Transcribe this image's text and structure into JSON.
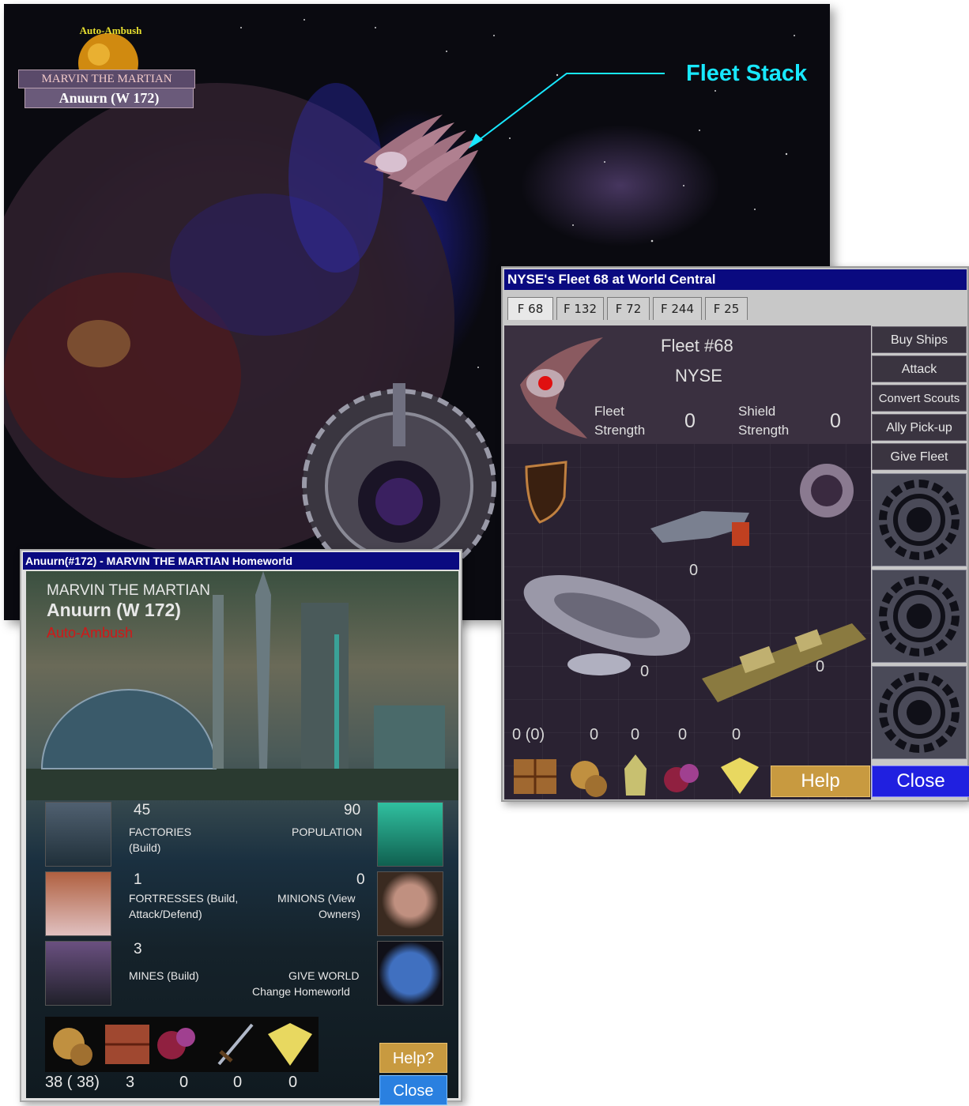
{
  "scene": {
    "world_status_label": "Auto-Ambush",
    "owner_label": "MARVIN THE MARTIAN",
    "world_label": "Anuurn (W 172)",
    "annotation": "Fleet Stack",
    "annotation_color": "#18e8ff"
  },
  "fleet_window": {
    "title": "NYSE's Fleet 68 at World Central",
    "tabs": [
      "F 68",
      "F 132",
      "F 72",
      "F 244",
      "F 25"
    ],
    "fleet_name": "Fleet #68",
    "owner": "NYSE",
    "fleet_strength_label_1": "Fleet",
    "fleet_strength_label_2": "Strength",
    "fleet_strength_value": "0",
    "shield_strength_label_1": "Shield",
    "shield_strength_label_2": "Strength",
    "shield_strength_value": "0",
    "side_buttons": [
      "Buy Ships",
      "Attack",
      "Convert Scouts",
      "Ally Pick-up",
      "Give Fleet"
    ],
    "ship_counts": {
      "fighter": "0",
      "saucer": "0",
      "cruiser": "0"
    },
    "resource_counts": [
      "0 (0)",
      "0",
      "0",
      "0",
      "0"
    ],
    "help_label": "Help",
    "close_label": "Close",
    "title_bar_color": "#0a0a80",
    "close_color": "#2020e0",
    "help_color": "#c89a40"
  },
  "homeworld_window": {
    "title": "Anuurn(#172) - MARVIN THE MARTIAN Homeworld",
    "owner": "MARVIN THE MARTIAN",
    "world": "Anuurn (W 172)",
    "status": "Auto-Ambush",
    "status_color": "#d01818",
    "stats": {
      "factories_value": "45",
      "factories_label": "FACTORIES",
      "factories_action": "(Build)",
      "population_value": "90",
      "population_label": "POPULATION",
      "fortresses_value": "1",
      "fortresses_label": "FORTRESSES (Build,",
      "fortresses_label_2": "Attack/Defend)",
      "minions_value": "0",
      "minions_label": "MINIONS (View",
      "minions_label_2": "Owners)",
      "mines_value": "3",
      "mines_label": "MINES (Build)",
      "give_world_label": "GIVE WORLD",
      "change_homeworld_label": "Change Homeworld"
    },
    "resource_counts": [
      "38 ( 38)",
      "3",
      "0",
      "0",
      "0"
    ],
    "help_label": "Help?",
    "close_label": "Close"
  }
}
